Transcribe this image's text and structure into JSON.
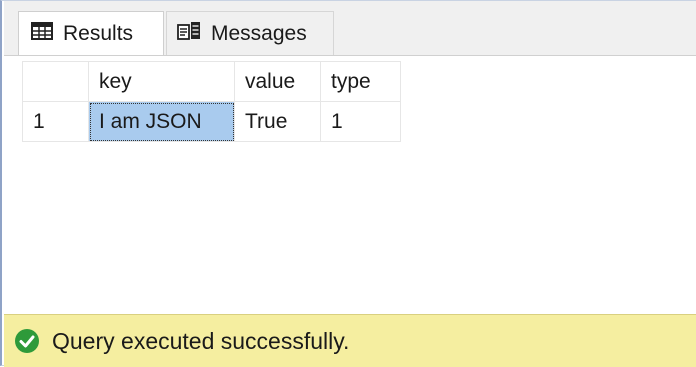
{
  "tabs": [
    {
      "label": "Results",
      "icon": "grid-icon",
      "active": true
    },
    {
      "label": "Messages",
      "icon": "messages-icon",
      "active": false
    }
  ],
  "grid": {
    "columns": [
      "",
      "key",
      "value",
      "type"
    ],
    "rows": [
      {
        "row_num": "1",
        "key": "I am JSON",
        "value": "True",
        "type": "1"
      }
    ],
    "selected_cell": "key",
    "selection_color": "#a9cbee"
  },
  "status": {
    "text": "Query executed successfully.",
    "icon": "check-circle-icon",
    "background": "#f5eea0",
    "icon_color": "#2e9a3a"
  }
}
